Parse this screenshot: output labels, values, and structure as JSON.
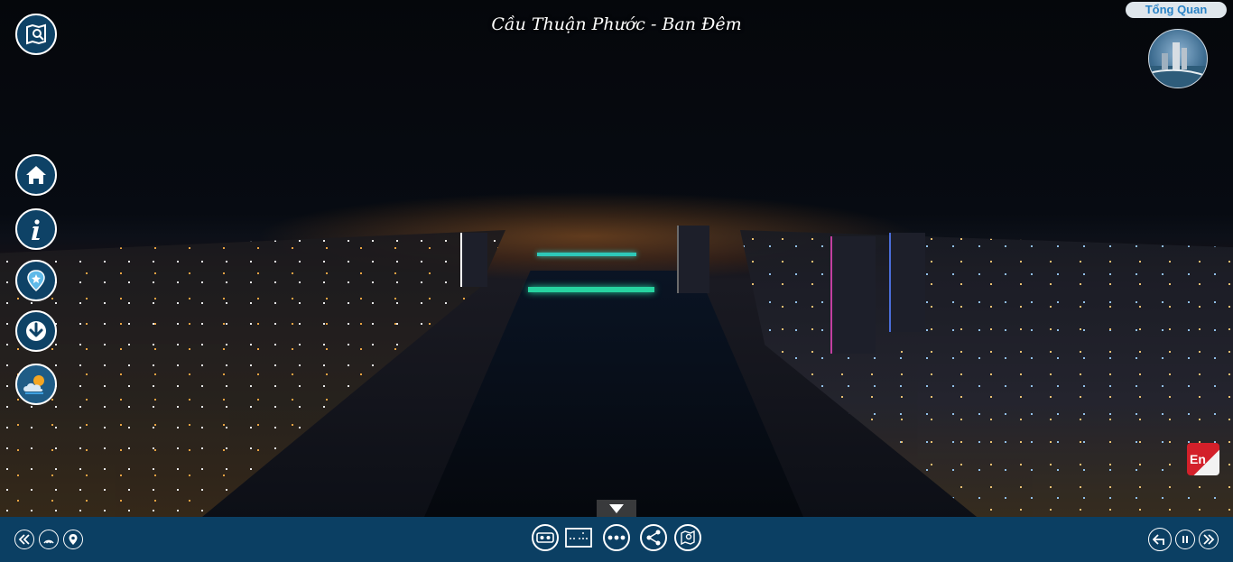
{
  "scene": {
    "title": "Cầu Thuận Phước - Ban Đêm"
  },
  "overview": {
    "label": "Tổng Quan"
  },
  "language": {
    "label": "En"
  },
  "left_toolbar": [
    {
      "name": "map-search",
      "icon": "map-search-icon"
    },
    {
      "name": "home",
      "icon": "home-icon"
    },
    {
      "name": "info",
      "icon": "info-icon"
    },
    {
      "name": "location",
      "icon": "location-pin-icon"
    },
    {
      "name": "download",
      "icon": "download-icon"
    },
    {
      "name": "weather",
      "icon": "weather-icon"
    }
  ],
  "bottom_bar": {
    "left": [
      "rewind-icon",
      "gyro-icon",
      "location-icon"
    ],
    "center": [
      "vr-icon",
      "floorplan-icon",
      "more-icon",
      "share-icon",
      "map-icon"
    ],
    "right": [
      "back-icon",
      "pause-icon",
      "forward-icon"
    ]
  },
  "colors": {
    "bar": "#0b3f63",
    "button": "#0e4266",
    "overview_text": "#2a83c6",
    "lang": "#d3202a"
  }
}
